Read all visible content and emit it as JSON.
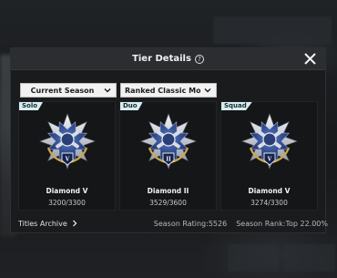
{
  "modal": {
    "title": "Tier Details",
    "help_glyph": "?"
  },
  "filters": {
    "season": "Current Season",
    "mode": "Ranked Classic Mode (TP)"
  },
  "cards": [
    {
      "badge": "Solo",
      "tier_roman": "V",
      "tier_name": "Diamond V",
      "points": "3200/3300"
    },
    {
      "badge": "Duo",
      "tier_roman": "II",
      "tier_name": "Diamond II",
      "points": "3529/3600"
    },
    {
      "badge": "Squad",
      "tier_roman": "V",
      "tier_name": "Diamond V",
      "points": "3274/3300"
    }
  ],
  "footer": {
    "archive_label": "Titles Archive",
    "season_rating": "Season Rating:5526",
    "season_rank": "Season Rank:Top 22.00%"
  },
  "colors": {
    "badge_bg": "#d7eef0",
    "modal_header": "#2b2d31",
    "emblem_blue": "#2e4d8f",
    "emblem_silver": "#c8ccd4"
  },
  "icons": [
    "help-icon",
    "close-icon",
    "chevron-down-icon",
    "chevron-right-icon",
    "diamond-tier-emblem-icon"
  ]
}
